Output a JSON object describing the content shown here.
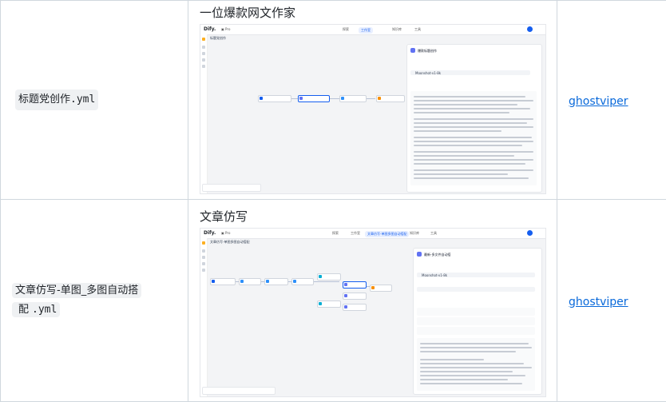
{
  "rows": [
    {
      "filename_main": "标题党创作",
      "filename_ext": ".yml",
      "title": "一位爆款网文作家",
      "author": "ghostviper",
      "screenshot": {
        "logo": "Dify.",
        "panel_title": "爆款标题创作",
        "model": "Moonshot-v1-8k"
      }
    },
    {
      "filename_main": "文章仿写-单图_多图自动搭",
      "filename_main2": "配",
      "filename_ext": ".yml",
      "title": "文章仿写",
      "author": "ghostviper",
      "screenshot": {
        "logo": "Dify.",
        "panel_title": "最新-多文件自动搭",
        "model": "Moonshot-v1-8k"
      }
    }
  ]
}
